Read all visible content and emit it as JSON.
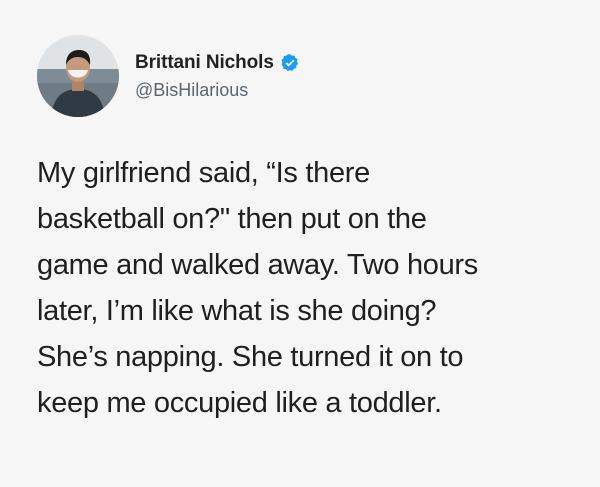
{
  "tweet": {
    "author": {
      "display_name": "Brittani Nichols",
      "handle": "@BisHilarious",
      "verified": true,
      "avatar_icon": "profile-photo"
    },
    "body_lines": [
      "My girlfriend said, “Is there",
      "basketball on?\" then put on the",
      "game and walked away. Two hours",
      "later, I’m like what is she doing?",
      "She’s napping. She turned it on to",
      "keep me occupied like a toddler."
    ]
  },
  "colors": {
    "background": "#f6f6f6",
    "text": "#1f1f1f",
    "handle": "#5b6670",
    "verified_badge": "#1d9bf0"
  }
}
